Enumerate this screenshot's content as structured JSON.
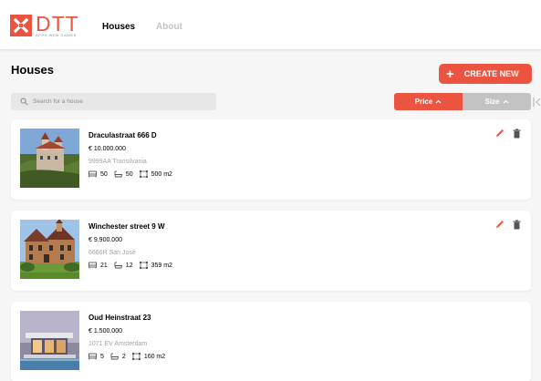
{
  "brand": {
    "name": "DTT",
    "tagline": "APPS WEB GAMES",
    "accent_color": "#eb5440",
    "logo_icon": "cross-logo-icon"
  },
  "nav": {
    "items": [
      {
        "label": "Houses",
        "active": true
      },
      {
        "label": "About",
        "active": false
      }
    ]
  },
  "main": {
    "title": "Houses",
    "create_button": "CREATE NEW",
    "search": {
      "placeholder": "Search for a house",
      "value": ""
    },
    "sort": {
      "price_label": "Price",
      "size_label": "Size",
      "active": "Price",
      "active_color": "#eb5440",
      "inactive_color": "#c3c3c3"
    }
  },
  "houses": [
    {
      "title": "Draculastraat 666 D",
      "price": "€ 10.000.000",
      "address": "9999AA Transilvania",
      "bedrooms": "50",
      "bathrooms": "50",
      "size": "500 m2",
      "editable": true,
      "image": "castle-photo"
    },
    {
      "title": "Winchester street 9 W",
      "price": "€ 9.900.000",
      "address": "6666R San José",
      "bedrooms": "21",
      "bathrooms": "12",
      "size": "359 m2",
      "editable": true,
      "image": "mansion-photo"
    },
    {
      "title": "Oud Heinstraat 23",
      "price": "€ 1.500.000",
      "address": "1071 EV Amsterdam",
      "bedrooms": "5",
      "bathrooms": "2",
      "size": "160 m2",
      "editable": false,
      "image": "modern-house-photo"
    }
  ]
}
